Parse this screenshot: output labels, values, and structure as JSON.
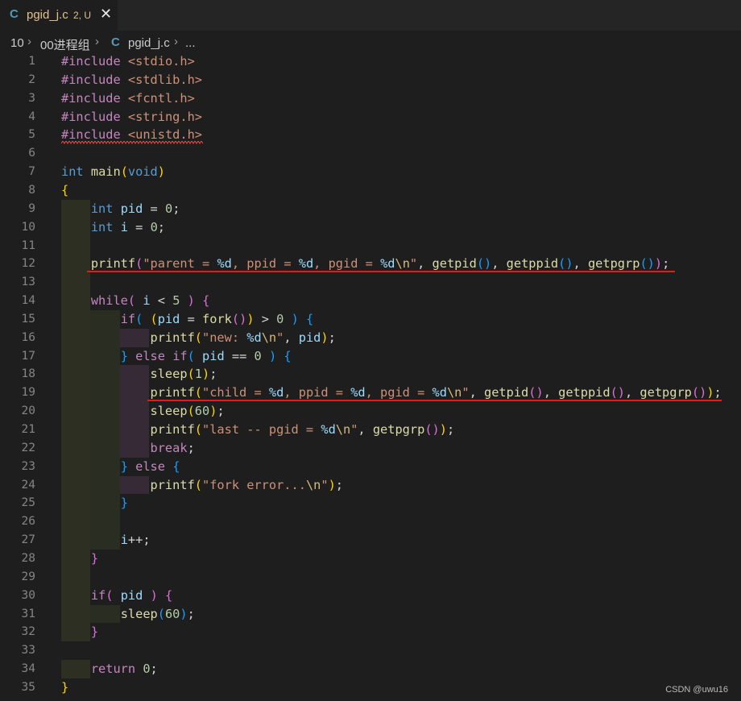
{
  "tab": {
    "filename": "pgid_j.c",
    "status": "2, U",
    "lang_icon": "C",
    "close_icon": "close-icon"
  },
  "breadcrumb": {
    "folder1": "10",
    "folder2": "00进程组",
    "file_icon": "C",
    "file": "pgid_j.c",
    "more": "..."
  },
  "colors": {
    "background": "#1e1e1e",
    "keyword": "#c586c0",
    "type": "#569cd6",
    "function": "#dcdcaa",
    "variable": "#9cdcfe",
    "number": "#b5cea8",
    "string": "#ce9178",
    "annotation_red": "#e51a1a"
  },
  "code_lines": [
    {
      "n": "1",
      "tokens": [
        [
          "k",
          "#include"
        ],
        [
          "",
          "&nbsp;"
        ],
        [
          "s",
          "<stdio.h>"
        ]
      ]
    },
    {
      "n": "2",
      "tokens": [
        [
          "k",
          "#include"
        ],
        [
          "",
          ""
        ],
        [
          "s",
          " <stdlib.h>"
        ]
      ]
    },
    {
      "n": "3",
      "tokens": [
        [
          "k",
          "#include"
        ],
        [
          "s",
          " <fcntl.h>"
        ]
      ]
    },
    {
      "n": "4",
      "tokens": [
        [
          "k",
          "#include"
        ],
        [
          "s",
          " <string.h>"
        ]
      ]
    },
    {
      "n": "5",
      "tokens": [
        [
          "k",
          "#include"
        ],
        [
          "s",
          " <unistd.h>"
        ]
      ]
    },
    {
      "n": "6",
      "tokens": []
    },
    {
      "n": "7",
      "tokens": [
        [
          "t",
          "int"
        ],
        [
          "",
          " "
        ],
        [
          "f",
          "main"
        ],
        [
          "p1",
          "("
        ],
        [
          "t",
          "void"
        ],
        [
          "p1",
          ")"
        ]
      ]
    },
    {
      "n": "8",
      "tokens": [
        [
          "p1",
          "{"
        ]
      ]
    },
    {
      "n": "9",
      "tokens": [
        [
          "",
          "    "
        ],
        [
          "t",
          "int"
        ],
        [
          "",
          " "
        ],
        [
          "v",
          "pid"
        ],
        [
          "",
          " = "
        ],
        [
          "n",
          "0"
        ],
        [
          "",
          ";"
        ]
      ]
    },
    {
      "n": "10",
      "tokens": [
        [
          "",
          "    "
        ],
        [
          "t",
          "int"
        ],
        [
          "",
          " "
        ],
        [
          "v",
          "i"
        ],
        [
          "",
          " = "
        ],
        [
          "n",
          "0"
        ],
        [
          "",
          ";"
        ]
      ]
    },
    {
      "n": "11",
      "tokens": []
    },
    {
      "n": "12",
      "tokens": [
        [
          "",
          "    "
        ],
        [
          "f",
          "printf"
        ],
        [
          "p2",
          "("
        ],
        [
          "s",
          "\"parent = "
        ],
        [
          "fmt",
          "%d"
        ],
        [
          "s",
          ", ppid = "
        ],
        [
          "fmt",
          "%d"
        ],
        [
          "s",
          ", pgid = "
        ],
        [
          "fmt",
          "%d"
        ],
        [
          "e",
          "\\n"
        ],
        [
          "s",
          "\""
        ],
        [
          "",
          ", "
        ],
        [
          "f",
          "getpid"
        ],
        [
          "p3",
          "()"
        ],
        [
          "",
          ", "
        ],
        [
          "f",
          "getppid"
        ],
        [
          "p3",
          "()"
        ],
        [
          "",
          ", "
        ],
        [
          "f",
          "getpgrp"
        ],
        [
          "p3",
          "()"
        ],
        [
          "p2",
          ")"
        ],
        [
          "",
          ";"
        ]
      ]
    },
    {
      "n": "13",
      "tokens": []
    },
    {
      "n": "14",
      "tokens": [
        [
          "",
          "    "
        ],
        [
          "k",
          "while"
        ],
        [
          "p2",
          "("
        ],
        [
          "",
          " "
        ],
        [
          "v",
          "i"
        ],
        [
          "",
          " < "
        ],
        [
          "n",
          "5"
        ],
        [
          "",
          " "
        ],
        [
          "p2",
          ")"
        ],
        [
          "",
          " "
        ],
        [
          "p2",
          "{"
        ]
      ]
    },
    {
      "n": "15",
      "tokens": [
        [
          "",
          "        "
        ],
        [
          "k",
          "if"
        ],
        [
          "p3",
          "("
        ],
        [
          "",
          " "
        ],
        [
          "p1",
          "("
        ],
        [
          "v",
          "pid"
        ],
        [
          "",
          " = "
        ],
        [
          "f",
          "fork"
        ],
        [
          "p2",
          "()"
        ],
        [
          "p1",
          ")"
        ],
        [
          "",
          " > "
        ],
        [
          "n",
          "0"
        ],
        [
          "",
          " "
        ],
        [
          "p3",
          ")"
        ],
        [
          "",
          " "
        ],
        [
          "p3",
          "{"
        ]
      ]
    },
    {
      "n": "16",
      "tokens": [
        [
          "",
          "            "
        ],
        [
          "f",
          "printf"
        ],
        [
          "p1",
          "("
        ],
        [
          "s",
          "\"new: "
        ],
        [
          "fmt",
          "%d"
        ],
        [
          "e",
          "\\n"
        ],
        [
          "s",
          "\""
        ],
        [
          "",
          ", "
        ],
        [
          "v",
          "pid"
        ],
        [
          "p1",
          ")"
        ],
        [
          "",
          ";"
        ]
      ]
    },
    {
      "n": "17",
      "tokens": [
        [
          "",
          "        "
        ],
        [
          "p3",
          "}"
        ],
        [
          "",
          " "
        ],
        [
          "k",
          "else"
        ],
        [
          "",
          " "
        ],
        [
          "k",
          "if"
        ],
        [
          "p3",
          "("
        ],
        [
          "",
          " "
        ],
        [
          "v",
          "pid"
        ],
        [
          "",
          " == "
        ],
        [
          "n",
          "0"
        ],
        [
          "",
          " "
        ],
        [
          "p3",
          ")"
        ],
        [
          "",
          " "
        ],
        [
          "p3",
          "{"
        ]
      ]
    },
    {
      "n": "18",
      "tokens": [
        [
          "",
          "            "
        ],
        [
          "f",
          "sleep"
        ],
        [
          "p1",
          "("
        ],
        [
          "n",
          "1"
        ],
        [
          "p1",
          ")"
        ],
        [
          "",
          ";"
        ]
      ]
    },
    {
      "n": "19",
      "tokens": [
        [
          "",
          "            "
        ],
        [
          "f",
          "printf"
        ],
        [
          "p1",
          "("
        ],
        [
          "s",
          "\"child = "
        ],
        [
          "fmt",
          "%d"
        ],
        [
          "s",
          ", ppid = "
        ],
        [
          "fmt",
          "%d"
        ],
        [
          "s",
          ", pgid = "
        ],
        [
          "fmt",
          "%d"
        ],
        [
          "e",
          "\\n"
        ],
        [
          "s",
          "\""
        ],
        [
          "",
          ", "
        ],
        [
          "f",
          "getpid"
        ],
        [
          "p2",
          "()"
        ],
        [
          "",
          ", "
        ],
        [
          "f",
          "getppid"
        ],
        [
          "p2",
          "()"
        ],
        [
          "",
          ", "
        ],
        [
          "f",
          "getpgrp"
        ],
        [
          "p2",
          "()"
        ],
        [
          "p1",
          ")"
        ],
        [
          "",
          ";"
        ]
      ]
    },
    {
      "n": "20",
      "tokens": [
        [
          "",
          "            "
        ],
        [
          "f",
          "sleep"
        ],
        [
          "p1",
          "("
        ],
        [
          "n",
          "60"
        ],
        [
          "p1",
          ")"
        ],
        [
          "",
          ";"
        ]
      ]
    },
    {
      "n": "21",
      "tokens": [
        [
          "",
          "            "
        ],
        [
          "f",
          "printf"
        ],
        [
          "p1",
          "("
        ],
        [
          "s",
          "\"last -- pgid = "
        ],
        [
          "fmt",
          "%d"
        ],
        [
          "e",
          "\\n"
        ],
        [
          "s",
          "\""
        ],
        [
          "",
          ", "
        ],
        [
          "f",
          "getpgrp"
        ],
        [
          "p2",
          "()"
        ],
        [
          "p1",
          ")"
        ],
        [
          "",
          ";"
        ]
      ]
    },
    {
      "n": "22",
      "tokens": [
        [
          "",
          "            "
        ],
        [
          "k",
          "break"
        ],
        [
          "",
          ";"
        ]
      ]
    },
    {
      "n": "23",
      "tokens": [
        [
          "",
          "        "
        ],
        [
          "p3",
          "}"
        ],
        [
          "",
          " "
        ],
        [
          "k",
          "else"
        ],
        [
          "",
          " "
        ],
        [
          "p3",
          "{"
        ]
      ]
    },
    {
      "n": "24",
      "tokens": [
        [
          "",
          "            "
        ],
        [
          "f",
          "printf"
        ],
        [
          "p1",
          "("
        ],
        [
          "s",
          "\"fork error..."
        ],
        [
          "e",
          "\\n"
        ],
        [
          "s",
          "\""
        ],
        [
          "p1",
          ")"
        ],
        [
          "",
          ";"
        ]
      ]
    },
    {
      "n": "25",
      "tokens": [
        [
          "",
          "        "
        ],
        [
          "p3",
          "}"
        ]
      ]
    },
    {
      "n": "26",
      "tokens": []
    },
    {
      "n": "27",
      "tokens": [
        [
          "",
          "        "
        ],
        [
          "v",
          "i"
        ],
        [
          "",
          "++;"
        ]
      ]
    },
    {
      "n": "28",
      "tokens": [
        [
          "",
          "    "
        ],
        [
          "p2",
          "}"
        ]
      ]
    },
    {
      "n": "29",
      "tokens": []
    },
    {
      "n": "30",
      "tokens": [
        [
          "",
          "    "
        ],
        [
          "k",
          "if"
        ],
        [
          "p2",
          "("
        ],
        [
          "",
          " "
        ],
        [
          "v",
          "pid"
        ],
        [
          "",
          " "
        ],
        [
          "p2",
          ")"
        ],
        [
          "",
          " "
        ],
        [
          "p2",
          "{"
        ]
      ]
    },
    {
      "n": "31",
      "tokens": [
        [
          "",
          "        "
        ],
        [
          "f",
          "sleep"
        ],
        [
          "p3",
          "("
        ],
        [
          "n",
          "60"
        ],
        [
          "p3",
          ")"
        ],
        [
          "",
          ";"
        ]
      ]
    },
    {
      "n": "32",
      "tokens": [
        [
          "",
          "    "
        ],
        [
          "p2",
          "}"
        ]
      ]
    },
    {
      "n": "33",
      "tokens": []
    },
    {
      "n": "34",
      "tokens": [
        [
          "",
          "    "
        ],
        [
          "k",
          "return"
        ],
        [
          "",
          " "
        ],
        [
          "n",
          "0"
        ],
        [
          "",
          ";"
        ]
      ]
    },
    {
      "n": "35",
      "tokens": [
        [
          "p1",
          "}"
        ]
      ]
    }
  ],
  "watermark": "CSDN @uwu16"
}
